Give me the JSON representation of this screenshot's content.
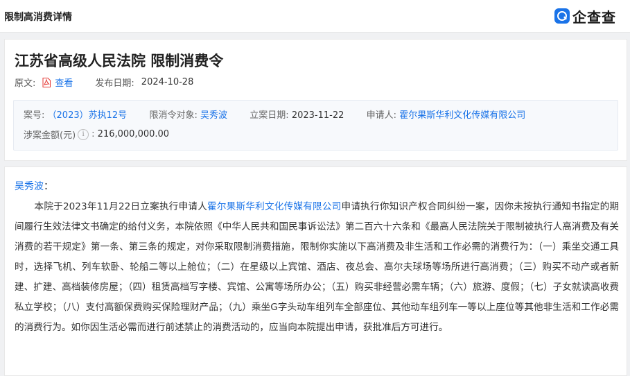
{
  "header": {
    "title": "限制高消费详情",
    "brand": "企查查"
  },
  "order": {
    "title": "江苏省高级人民法院 限制消费令",
    "original_label": "原文:",
    "view_label": "查看",
    "publish_label": "发布日期:",
    "publish_date": "2024-10-28",
    "case_no_label": "案号:",
    "case_no": "（2023）苏执12号",
    "target_label": "限消令对象:",
    "target": "吴秀波",
    "filing_label": "立案日期:",
    "filing_date": "2023-11-22",
    "applicant_label": "申请人:",
    "applicant": "霍尔果斯华利文化传媒有限公司",
    "amount_label": "涉案金额(元)",
    "amount": "216,000,000.00"
  },
  "document": {
    "salutation_name": "吴秀波",
    "salutation_colon": "：",
    "text_part1": "本院于2023年11月22日立案执行申请人",
    "applicant_link": "霍尔果斯华利文化传媒有限公司",
    "text_part2": "申请执行你知识产权合同纠纷一案，因你未按执行通知书指定的期间履行生效法律文书确定的给付义务，本院依照《中华人民共和国民事诉讼法》第二百六十六条和《最高人民法院关于限制被执行人高消费及有关消费的若干规定》第一条、第三条的规定，对你采取限制消费措施，限制你实施以下高消费及非生活和工作必需的消费行为：（一）乘坐交通工具时，选择飞机、列车软卧、轮船二等以上舱位；（二）在星级以上宾馆、酒店、夜总会、高尔夫球场等场所进行高消费；（三）购买不动产或者新建、扩建、高档装修房屋；（四）租赁高档写字楼、宾馆、公寓等场所办公；（五）购买非经营必需车辆；（六）旅游、度假；（七）子女就读高收费私立学校；（八）支付高额保费购买保险理财产品；（九）乘坐G字头动车组列车全部座位、其他动车组列车一等以上座位等其他非生活和工作必需的消费行为。如你因生活必需而进行前述禁止的消费活动的，应当向本院提出申请，获批准后方可进行。"
  },
  "colors": {
    "link": "#1a73e8",
    "background": "#f0f1f3"
  }
}
